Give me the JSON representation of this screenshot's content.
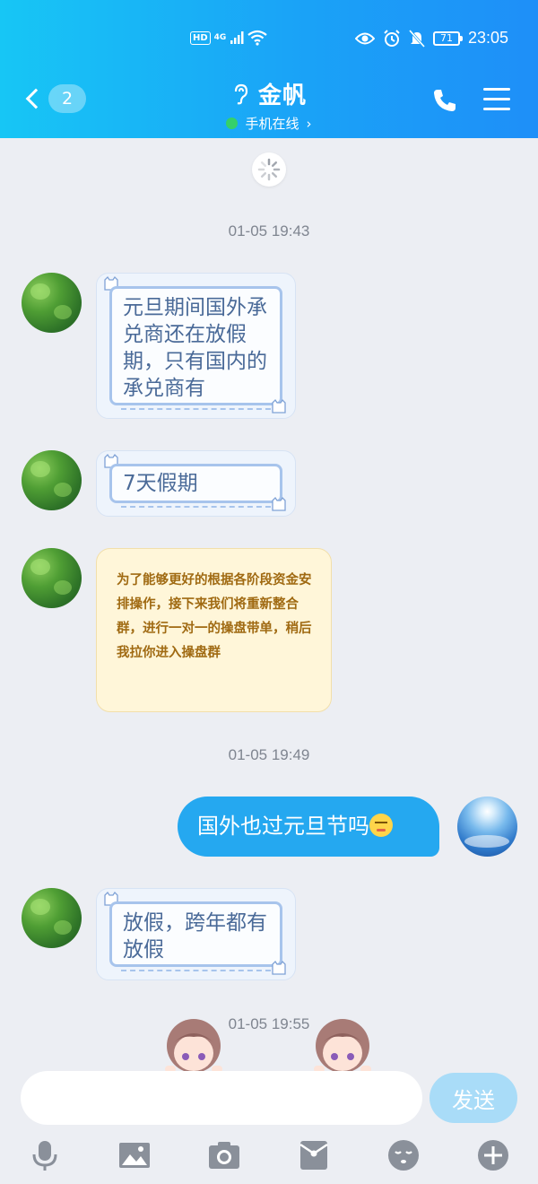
{
  "status_bar": {
    "hd": "HD",
    "network": "4G",
    "battery": "71",
    "time": "23:05"
  },
  "nav": {
    "unread_count": "2",
    "contact_name": "金帆",
    "contact_status": "手机在线",
    "status_chevron": "›"
  },
  "messages": [
    {
      "type": "timestamp",
      "text": "01-05 19:43"
    },
    {
      "type": "received",
      "text": "元旦期间国外承兑商还在放假期，只有国内的承兑商有"
    },
    {
      "type": "received",
      "text": "7天假期"
    },
    {
      "type": "received",
      "text": "为了能够更好的根据各阶段资金安排操作，接下来我们将重新整合群，进行一对一的操盘带单，稍后我拉你进入操盘群"
    },
    {
      "type": "timestamp",
      "text": "01-05 19:49"
    },
    {
      "type": "sent",
      "text": "国外也过元旦节吗"
    },
    {
      "type": "received",
      "text": "放假，跨年都有放假"
    },
    {
      "type": "timestamp",
      "text": "01-05 19:55"
    }
  ],
  "input": {
    "placeholder": "",
    "value": "",
    "send_label": "发送"
  },
  "toolbar_icons": [
    "microphone-icon",
    "image-icon",
    "camera-icon",
    "red-packet-icon",
    "emoji-icon",
    "plus-icon"
  ],
  "colors": {
    "header_start": "#17c6f5",
    "header_end": "#1e8ff8",
    "sent_bubble": "#25a8f0",
    "send_button": "#a9dcf8",
    "background": "#eceef3"
  }
}
